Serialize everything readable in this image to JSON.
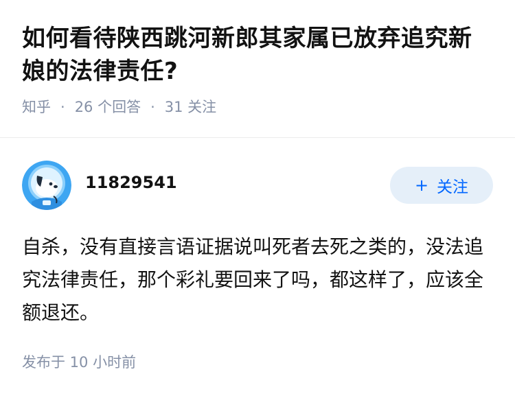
{
  "question": {
    "title": "如何看待陕西跳河新郎其家属已放弃追究新娘的法律责任?",
    "source": "知乎",
    "separator": "·",
    "answers_count": "26 个回答",
    "followers_count": "31 关注"
  },
  "answer": {
    "author_name": "11829541",
    "follow_plus": "+",
    "follow_label": "关注",
    "content": "自杀，没有直接言语证据说叫死者去死之类的，没法追究法律责任，那个彩礼要回来了吗，都这样了，应该全额退还。",
    "published": "发布于 10 小时前"
  },
  "colors": {
    "accent": "#0066ff",
    "follow_bg": "#e5eff9",
    "meta": "#8590a6",
    "text": "#121212"
  },
  "icons": {
    "avatar": "astronaut-dog-avatar"
  }
}
